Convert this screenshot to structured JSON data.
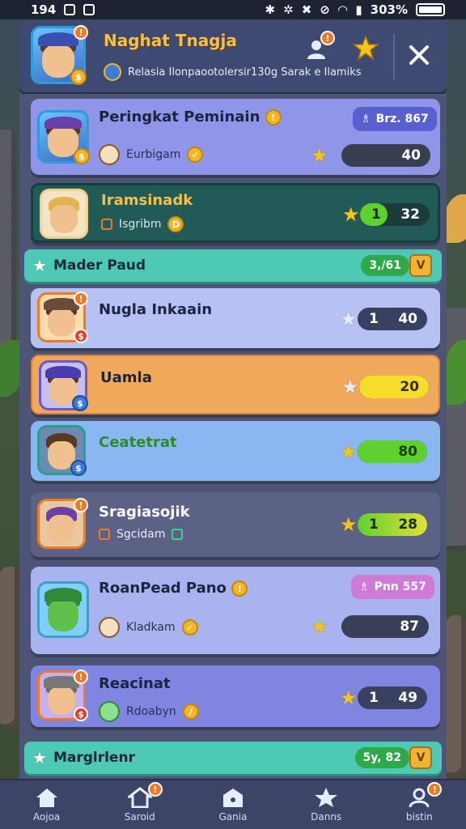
{
  "status_bar": {
    "time": "194",
    "battery": "303%"
  },
  "header": {
    "title": "Naghat Tnagja",
    "subtitle": "Relasia Ilonpaootolersir130g Sarak e Ilamiks",
    "avatar_badge": "!",
    "friends_badge": "!"
  },
  "cards": [
    {
      "name": "Peringkat Peminain",
      "meta": "Eurbigam",
      "badge": "Brz. 867",
      "score": "40",
      "lead": "",
      "fill": 0
    },
    {
      "name": "Iramsinadk",
      "meta": "Isgribm",
      "score": "32",
      "lead": "1",
      "fill": 0.2
    },
    {
      "name": "Nugla Inkaain",
      "meta": "",
      "score": "40",
      "lead": "1",
      "fill": 0
    },
    {
      "name": "Uamla",
      "meta": "",
      "score": "20",
      "lead": "",
      "fill": 1.0
    },
    {
      "name": "Ceatetrat",
      "meta": "",
      "score": "80",
      "lead": "",
      "fill": 1.0
    },
    {
      "name": "Sragiasojik",
      "meta": "Sgcidam",
      "score": "28",
      "lead": "1",
      "fill": 1.0
    },
    {
      "name": "RoanPead Pano",
      "meta": "Kladkam",
      "badge": "Pnn 557",
      "score": "87",
      "lead": "",
      "fill": 0
    },
    {
      "name": "Reacinat",
      "meta": "Rdoabyn",
      "score": "49",
      "lead": "1",
      "fill": 0
    }
  ],
  "sections": [
    {
      "label": "Mader Paud",
      "count": "3,/61"
    },
    {
      "label": "Marglrlenr",
      "count": "5y, 82"
    }
  ],
  "nav": [
    {
      "label": "Aojoa",
      "icon": "home-icon"
    },
    {
      "label": "Saroid",
      "icon": "house-icon"
    },
    {
      "label": "Gania",
      "icon": "hut-icon"
    },
    {
      "label": "Danns",
      "icon": "star-icon"
    },
    {
      "label": "bistin",
      "icon": "profile-icon"
    }
  ],
  "colors": {
    "card_purple": "#8f95e8",
    "card_teal": "#225a58",
    "card_lavender": "#b7c2f4",
    "card_orange": "#f0a85a",
    "card_blue": "#8ab6f2",
    "card_slate": "#5c6286",
    "card_lilac": "#a9b3f0",
    "section_teal": "#4dc9b6",
    "accent_gold": "#f6c047"
  }
}
